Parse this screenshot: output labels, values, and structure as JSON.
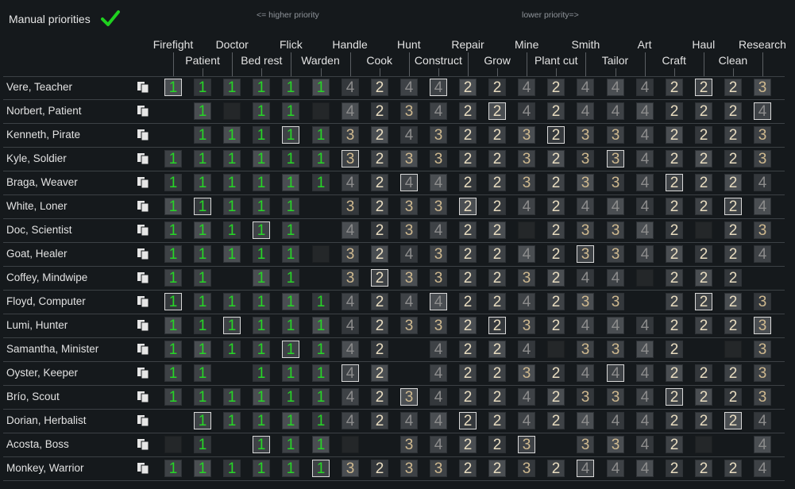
{
  "header": {
    "manual_label": "Manual priorities",
    "higher_hint": "<= higher priority",
    "lower_hint": "lower priority=>",
    "check_color": "#1fd11f"
  },
  "work_types": [
    "Firefight",
    "Patient",
    "Doctor",
    "Bed rest",
    "Flick",
    "Warden",
    "Handle",
    "Cook",
    "Hunt",
    "Construct",
    "Repair",
    "Grow",
    "Mine",
    "Plant cut",
    "Smith",
    "Tailor",
    "Art",
    "Craft",
    "Haul",
    "Clean",
    "Research"
  ],
  "pawns": [
    {
      "name": "Vere, Teacher",
      "cells": [
        "1",
        "1",
        "1",
        "1",
        "1",
        "1",
        "4",
        "2",
        "4",
        "4",
        "2",
        "2",
        "4",
        "2",
        "4",
        "4",
        "4",
        "2",
        "2",
        "2",
        "3"
      ]
    },
    {
      "name": "Norbert, Patient",
      "cells": [
        "",
        "1",
        "",
        "1",
        "1",
        "",
        "4",
        "2",
        "3",
        "4",
        "2",
        "2",
        "4",
        "2",
        "4",
        "4",
        "4",
        "2",
        "2",
        "2",
        "4"
      ]
    },
    {
      "name": "Kenneth, Pirate",
      "cells": [
        "",
        "1",
        "1",
        "1",
        "1",
        "1",
        "3",
        "2",
        "4",
        "3",
        "2",
        "2",
        "3",
        "2",
        "3",
        "3",
        "4",
        "2",
        "2",
        "2",
        "3"
      ]
    },
    {
      "name": "Kyle, Soldier",
      "cells": [
        "1",
        "1",
        "1",
        "1",
        "1",
        "1",
        "3",
        "2",
        "3",
        "3",
        "2",
        "2",
        "3",
        "2",
        "3",
        "3",
        "4",
        "2",
        "2",
        "2",
        "3"
      ]
    },
    {
      "name": "Braga, Weaver",
      "cells": [
        "1",
        "1",
        "1",
        "1",
        "1",
        "1",
        "4",
        "2",
        "4",
        "4",
        "2",
        "2",
        "3",
        "2",
        "3",
        "3",
        "4",
        "2",
        "2",
        "2",
        "4"
      ]
    },
    {
      "name": "White, Loner",
      "cells": [
        "1",
        "1",
        "1",
        "1",
        "1",
        "",
        "3",
        "2",
        "3",
        "3",
        "2",
        "2",
        "4",
        "2",
        "4",
        "4",
        "4",
        "2",
        "2",
        "2",
        "4"
      ]
    },
    {
      "name": "Doc, Scientist",
      "cells": [
        "1",
        "1",
        "1",
        "1",
        "1",
        "",
        "4",
        "2",
        "3",
        "4",
        "2",
        "2",
        "",
        "2",
        "3",
        "3",
        "4",
        "2",
        "",
        "2",
        "3"
      ]
    },
    {
      "name": "Goat, Healer",
      "cells": [
        "1",
        "1",
        "1",
        "1",
        "1",
        "",
        "3",
        "2",
        "4",
        "3",
        "2",
        "2",
        "4",
        "2",
        "3",
        "3",
        "4",
        "2",
        "2",
        "2",
        "4"
      ]
    },
    {
      "name": "Coffey, Mindwipe",
      "cells": [
        "1",
        "1",
        "",
        "1",
        "1",
        "",
        "3",
        "2",
        "3",
        "3",
        "2",
        "2",
        "3",
        "2",
        "4",
        "4",
        "",
        "2",
        "2",
        "2",
        ""
      ]
    },
    {
      "name": "Floyd, Computer",
      "cells": [
        "1",
        "1",
        "1",
        "1",
        "1",
        "1",
        "4",
        "2",
        "4",
        "4",
        "2",
        "2",
        "4",
        "2",
        "3",
        "3",
        "",
        "2",
        "2",
        "2",
        "3"
      ]
    },
    {
      "name": "Lumi, Hunter",
      "cells": [
        "1",
        "1",
        "1",
        "1",
        "1",
        "1",
        "4",
        "2",
        "3",
        "3",
        "2",
        "2",
        "3",
        "2",
        "4",
        "4",
        "4",
        "2",
        "2",
        "2",
        "3"
      ]
    },
    {
      "name": "Samantha, Minister",
      "cells": [
        "1",
        "1",
        "1",
        "1",
        "1",
        "1",
        "4",
        "2",
        "",
        "4",
        "2",
        "2",
        "4",
        "",
        "3",
        "3",
        "4",
        "2",
        "",
        "",
        "3"
      ]
    },
    {
      "name": "Oyster, Keeper",
      "cells": [
        "1",
        "1",
        "",
        "1",
        "1",
        "1",
        "4",
        "2",
        "",
        "4",
        "2",
        "2",
        "3",
        "2",
        "4",
        "4",
        "4",
        "2",
        "2",
        "2",
        "3"
      ]
    },
    {
      "name": "Brío, Scout",
      "cells": [
        "1",
        "1",
        "1",
        "1",
        "1",
        "1",
        "4",
        "2",
        "3",
        "4",
        "2",
        "2",
        "4",
        "2",
        "3",
        "3",
        "4",
        "2",
        "2",
        "2",
        "3"
      ]
    },
    {
      "name": "Dorian, Herbalist",
      "cells": [
        "",
        "1",
        "1",
        "1",
        "1",
        "1",
        "4",
        "2",
        "4",
        "4",
        "2",
        "2",
        "4",
        "2",
        "4",
        "4",
        "4",
        "2",
        "2",
        "2",
        "4"
      ]
    },
    {
      "name": "Acosta, Boss",
      "cells": [
        "",
        "1",
        "",
        "1",
        "1",
        "1",
        "",
        "",
        "3",
        "4",
        "2",
        "2",
        "3",
        "",
        "3",
        "3",
        "4",
        "2",
        "",
        "",
        "4"
      ]
    },
    {
      "name": "Monkey, Warrior",
      "cells": [
        "1",
        "1",
        "1",
        "1",
        "1",
        "1",
        "3",
        "2",
        "3",
        "3",
        "2",
        "2",
        "3",
        "2",
        "4",
        "4",
        "4",
        "2",
        "2",
        "2",
        "4"
      ]
    }
  ]
}
